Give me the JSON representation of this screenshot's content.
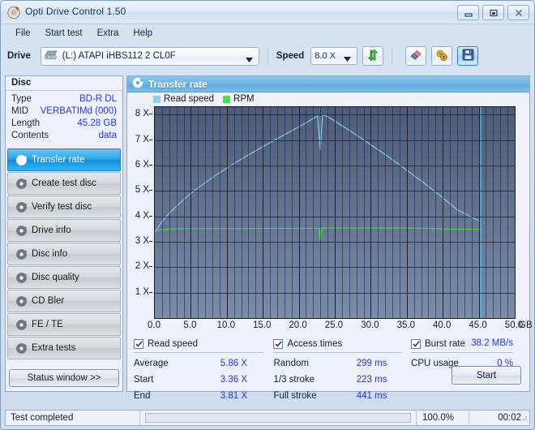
{
  "window": {
    "title": "Opti Drive Control 1.50",
    "icon": "disc-icon",
    "buttons": {
      "minimize": "minimize-icon",
      "maximize": "maximize-icon",
      "close": "close-icon"
    }
  },
  "menu": {
    "items": [
      "File",
      "Start test",
      "Extra",
      "Help"
    ]
  },
  "toolbar": {
    "drive_label": "Drive",
    "drive_value": "(L:)   ATAPI iHBS112   2 CL0F",
    "speed_label": "Speed",
    "speed_value": "8.0 X",
    "buttons": [
      {
        "name": "refresh-drive-button",
        "icon": "refresh-icon"
      },
      {
        "name": "erase-button",
        "icon": "eraser-icon"
      },
      {
        "name": "settings-button",
        "icon": "gears-icon"
      },
      {
        "name": "save-button",
        "icon": "floppy-icon"
      }
    ]
  },
  "disc": {
    "header": "Disc",
    "rows": [
      {
        "key": "Type",
        "value": "BD-R DL"
      },
      {
        "key": "MID",
        "value": "VERBATIMd (000)"
      },
      {
        "key": "Length",
        "value": "45.28 GB"
      },
      {
        "key": "Contents",
        "value": "data"
      }
    ]
  },
  "nav": {
    "items": [
      {
        "label": "Transfer rate",
        "selected": true
      },
      {
        "label": "Create test disc",
        "selected": false
      },
      {
        "label": "Verify test disc",
        "selected": false
      },
      {
        "label": "Drive info",
        "selected": false
      },
      {
        "label": "Disc info",
        "selected": false
      },
      {
        "label": "Disc quality",
        "selected": false
      },
      {
        "label": "CD Bler",
        "selected": false
      },
      {
        "label": "FE / TE",
        "selected": false
      },
      {
        "label": "Extra tests",
        "selected": false
      }
    ],
    "status_window_button": "Status window >>"
  },
  "panel": {
    "title": "Transfer rate",
    "icon": "disc-icon"
  },
  "chart_data": {
    "type": "line",
    "title": "Transfer rate",
    "xlabel": "GB",
    "ylabel": "X",
    "xlim": [
      0,
      50
    ],
    "ylim": [
      0,
      8.3
    ],
    "x_unit": "GB",
    "xticks": [
      "0.0",
      "5.0",
      "10.0",
      "15.0",
      "20.0",
      "25.0",
      "30.0",
      "35.0",
      "40.0",
      "45.0",
      "50.0"
    ],
    "xtick_values": [
      0,
      5,
      10,
      15,
      20,
      25,
      30,
      35,
      40,
      45,
      50
    ],
    "yticks": [
      "1 X",
      "2 X",
      "3 X",
      "4 X",
      "5 X",
      "6 X",
      "7 X",
      "8 X"
    ],
    "ytick_values": [
      1,
      2,
      3,
      4,
      5,
      6,
      7,
      8
    ],
    "grid": true,
    "legend_position": "top-left",
    "disc_end_gb": 45.28,
    "series": [
      {
        "name": "Read speed",
        "color": "#8ed0f5",
        "x": [
          0.0,
          1.0,
          2.0,
          3.0,
          4.0,
          5.0,
          6.0,
          7.0,
          8.0,
          9.0,
          10.0,
          11.0,
          12.0,
          13.0,
          14.0,
          15.0,
          16.0,
          17.0,
          18.0,
          19.0,
          20.0,
          21.0,
          22.0,
          22.6,
          23.0,
          23.3,
          23.6,
          24.0,
          25.0,
          26.0,
          27.0,
          28.0,
          29.0,
          30.0,
          31.0,
          32.0,
          33.0,
          34.0,
          35.0,
          36.0,
          37.0,
          38.0,
          39.0,
          40.0,
          41.0,
          42.0,
          43.0,
          44.0,
          45.0,
          45.28
        ],
        "y": [
          3.36,
          3.8,
          4.12,
          4.4,
          4.66,
          4.9,
          5.12,
          5.33,
          5.53,
          5.72,
          5.9,
          6.08,
          6.25,
          6.42,
          6.58,
          6.74,
          6.9,
          7.06,
          7.21,
          7.37,
          7.52,
          7.68,
          7.85,
          7.95,
          6.62,
          7.98,
          7.97,
          7.92,
          7.75,
          7.57,
          7.39,
          7.2,
          7.01,
          6.82,
          6.63,
          6.43,
          6.23,
          6.03,
          5.82,
          5.61,
          5.4,
          5.18,
          4.96,
          4.73,
          4.5,
          4.26,
          4.12,
          3.96,
          3.84,
          3.81
        ]
      },
      {
        "name": "RPM",
        "color": "#4ade4a",
        "x": [
          0.0,
          2.0,
          5.0,
          9.0,
          13.0,
          16.0,
          19.0,
          22.0,
          22.8,
          23.0,
          23.2,
          24.0,
          28.0,
          32.0,
          35.0,
          38.0,
          41.0,
          43.0,
          45.28
        ],
        "y": [
          3.44,
          3.5,
          3.52,
          3.52,
          3.52,
          3.53,
          3.53,
          3.53,
          3.53,
          3.06,
          3.54,
          3.54,
          3.54,
          3.54,
          3.54,
          3.53,
          3.5,
          3.49,
          3.49
        ]
      }
    ]
  },
  "results": {
    "read_speed": {
      "checkbox_label": "Read speed",
      "checked": true,
      "rows": [
        {
          "key": "Average",
          "value": "5.86 X"
        },
        {
          "key": "Start",
          "value": "3.36 X"
        },
        {
          "key": "End",
          "value": "3.81 X"
        }
      ]
    },
    "access_times": {
      "checkbox_label": "Access times",
      "checked": true,
      "rows": [
        {
          "key": "Random",
          "value": "299 ms"
        },
        {
          "key": "1/3 stroke",
          "value": "223 ms"
        },
        {
          "key": "Full stroke",
          "value": "441 ms"
        }
      ]
    },
    "burst_rate": {
      "checkbox_label": "Burst rate",
      "checked": true,
      "value": "38.2 MB/s",
      "rows": [
        {
          "key": "CPU usage",
          "value": "0 %"
        }
      ]
    },
    "start_button": "Start"
  },
  "statusbar": {
    "text": "Test completed",
    "percent": "100.0%",
    "progress": 100,
    "time": "00:02"
  }
}
